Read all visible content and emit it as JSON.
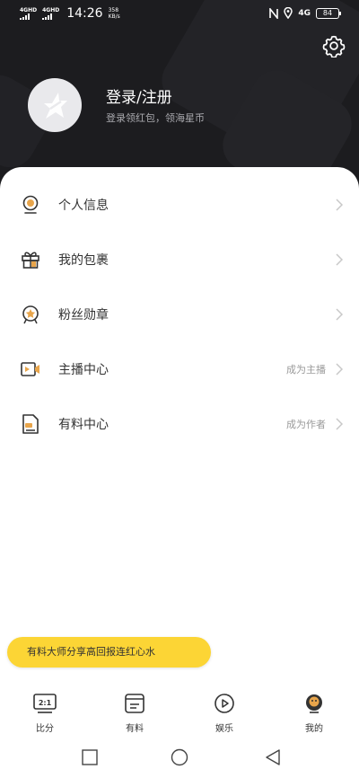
{
  "status_bar": {
    "sim1": "4GHD",
    "sim2": "4GHD",
    "time": "14:26",
    "speed_value": "358",
    "speed_unit": "KB/s",
    "network": "4G",
    "battery": "84"
  },
  "profile": {
    "login_title": "登录/注册",
    "login_subtitle": "登录领红包，领海星币"
  },
  "menu": [
    {
      "label": "个人信息",
      "hint": "",
      "icon": "user-badge-icon"
    },
    {
      "label": "我的包裹",
      "hint": "",
      "icon": "gift-box-icon"
    },
    {
      "label": "粉丝勋章",
      "hint": "",
      "icon": "medal-icon"
    },
    {
      "label": "主播中心",
      "hint": "成为主播",
      "icon": "video-camera-icon"
    },
    {
      "label": "有料中心",
      "hint": "成为作者",
      "icon": "document-icon"
    }
  ],
  "promo": {
    "text": "有料大师分享高回报连红心水"
  },
  "tabs": [
    {
      "label": "比分",
      "icon": "score-icon"
    },
    {
      "label": "有料",
      "icon": "notes-icon"
    },
    {
      "label": "娱乐",
      "icon": "play-icon"
    },
    {
      "label": "我的",
      "icon": "profile-icon"
    }
  ],
  "colors": {
    "header_bg": "#1c1c1f",
    "accent_yellow": "#fcd535",
    "icon_orange": "#e8a54b"
  }
}
